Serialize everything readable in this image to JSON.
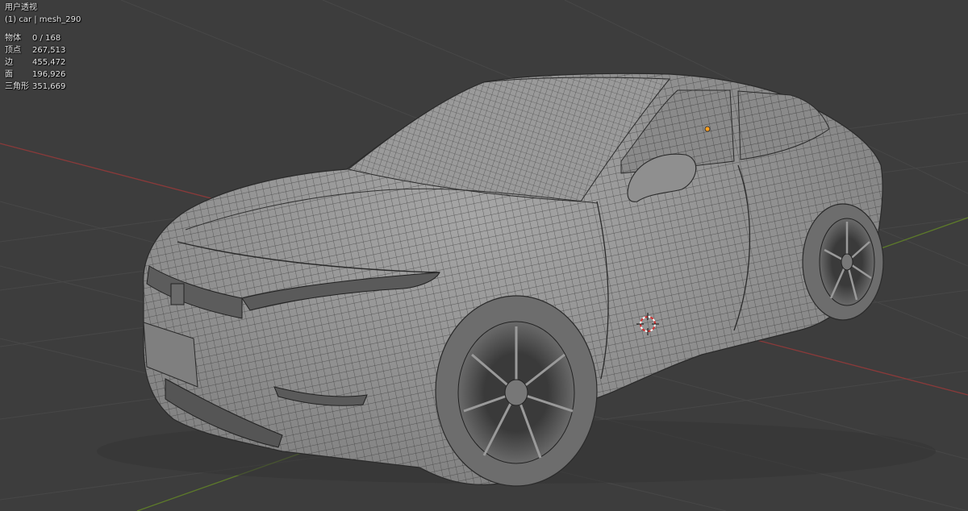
{
  "viewport": {
    "view_name": "用户透视",
    "object_info": "(1) car | mesh_290"
  },
  "stats": [
    {
      "label": "物体",
      "value": "0 / 168"
    },
    {
      "label": "顶点",
      "value": "267,513"
    },
    {
      "label": "边",
      "value": "455,472"
    },
    {
      "label": "面",
      "value": "196,926"
    },
    {
      "label": "三角形",
      "value": "351,669"
    }
  ],
  "colors": {
    "background": "#3d3d3d",
    "grid": "#4a4a4a",
    "x_axis": "#8a3a3a",
    "y_axis": "#5d7a2a",
    "mesh_fill": "#8c8c8c",
    "wire": "#2e2e2e",
    "origin_dot": "#ffa020",
    "cursor": "#d03030"
  },
  "icons": [
    "3d-cursor-icon",
    "object-origin-icon"
  ]
}
